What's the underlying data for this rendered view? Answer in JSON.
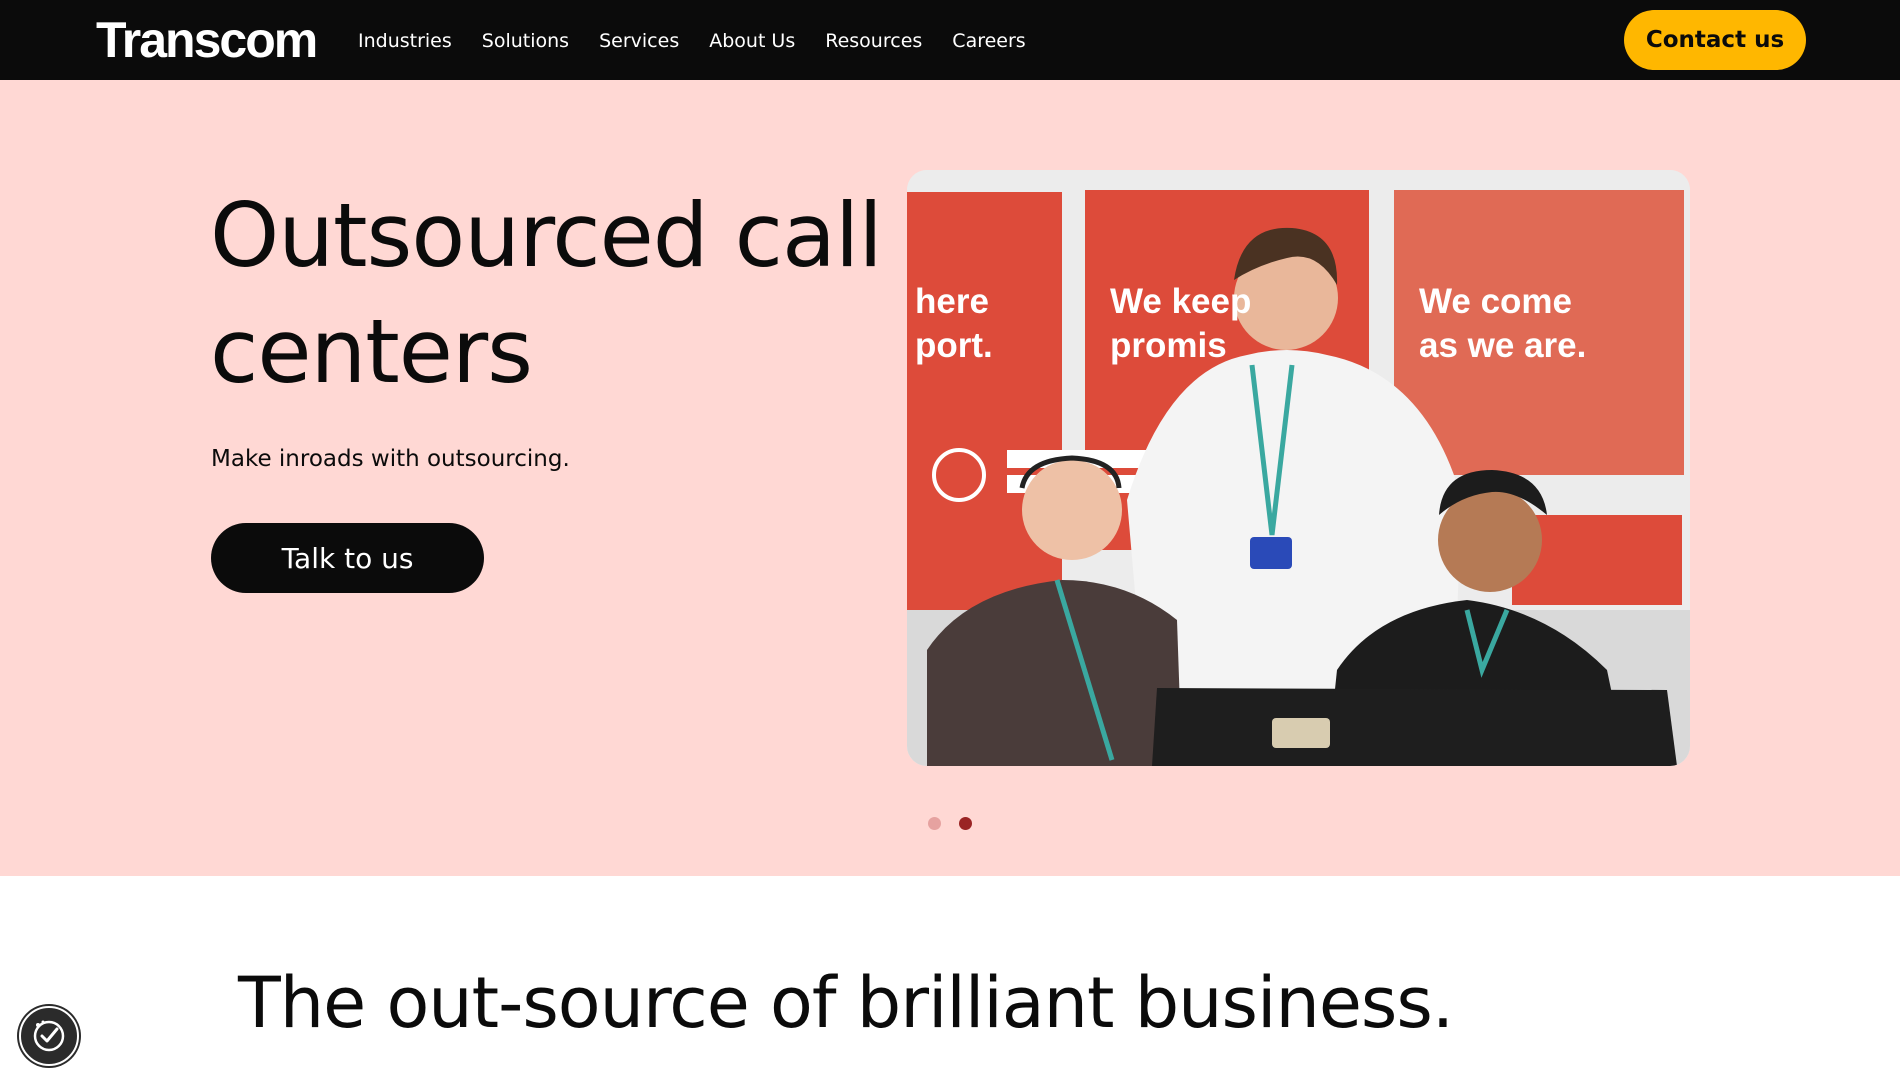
{
  "header": {
    "logo": "Transcom",
    "menu": [
      "Industries",
      "Solutions",
      "Services",
      "About Us",
      "Resources",
      "Careers"
    ],
    "contact_label": "Contact us"
  },
  "hero": {
    "title": "Outsourced call centers",
    "subtitle": "Make inroads with outsourcing.",
    "cta_label": "Talk to us",
    "poster_texts": [
      "here\nport.",
      "We keep\npromis",
      "We come\nas we are."
    ],
    "carousel": {
      "slides": 2,
      "active": 2
    }
  },
  "section": {
    "title": "The out-source of brilliant business."
  },
  "colors": {
    "nav_bg": "#0b0b0b",
    "hero_bg": "#ffd8d4",
    "accent_yellow": "#ffb700",
    "dot_active": "#9a2424",
    "dot_inactive": "#e6a2a0"
  },
  "icons": {
    "consent": "cookie-consent-icon"
  }
}
